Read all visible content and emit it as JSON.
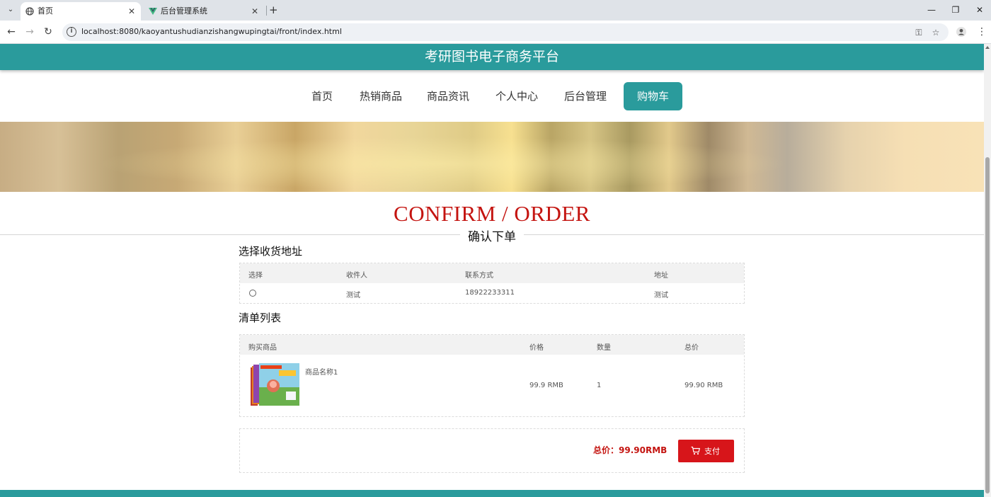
{
  "browser": {
    "tabs": [
      {
        "title": "首页",
        "icon": "globe-icon"
      },
      {
        "title": "后台管理系统",
        "icon": "vue-icon"
      }
    ],
    "url": "localhost:8080/kaoyantushudianzishangwupingtai/front/index.html"
  },
  "site": {
    "title": "考研图书电子商务平台",
    "nav": [
      "首页",
      "热销商品",
      "商品资讯",
      "个人中心",
      "后台管理",
      "购物车"
    ],
    "active_nav": "购物车",
    "brand_color": "#2a9b9c"
  },
  "heading": {
    "en": "CONFIRM / ORDER",
    "cn": "确认下单",
    "color": "#c41410"
  },
  "address": {
    "title": "选择收货地址",
    "headers": [
      "选择",
      "收件人",
      "联系方式",
      "地址"
    ],
    "rows": [
      {
        "selected": false,
        "name": "测试",
        "phone": "18922233311",
        "address": "测试"
      }
    ]
  },
  "order": {
    "title": "清单列表",
    "headers": [
      "购买商品",
      "价格",
      "数量",
      "总价"
    ],
    "items": [
      {
        "name": "商品名称1",
        "price": "99.9 RMB",
        "qty": "1",
        "total": "99.90 RMB"
      }
    ]
  },
  "summary": {
    "total": "总价：99.90RMB",
    "pay_label": "支付",
    "pay_color": "#d7151a"
  }
}
